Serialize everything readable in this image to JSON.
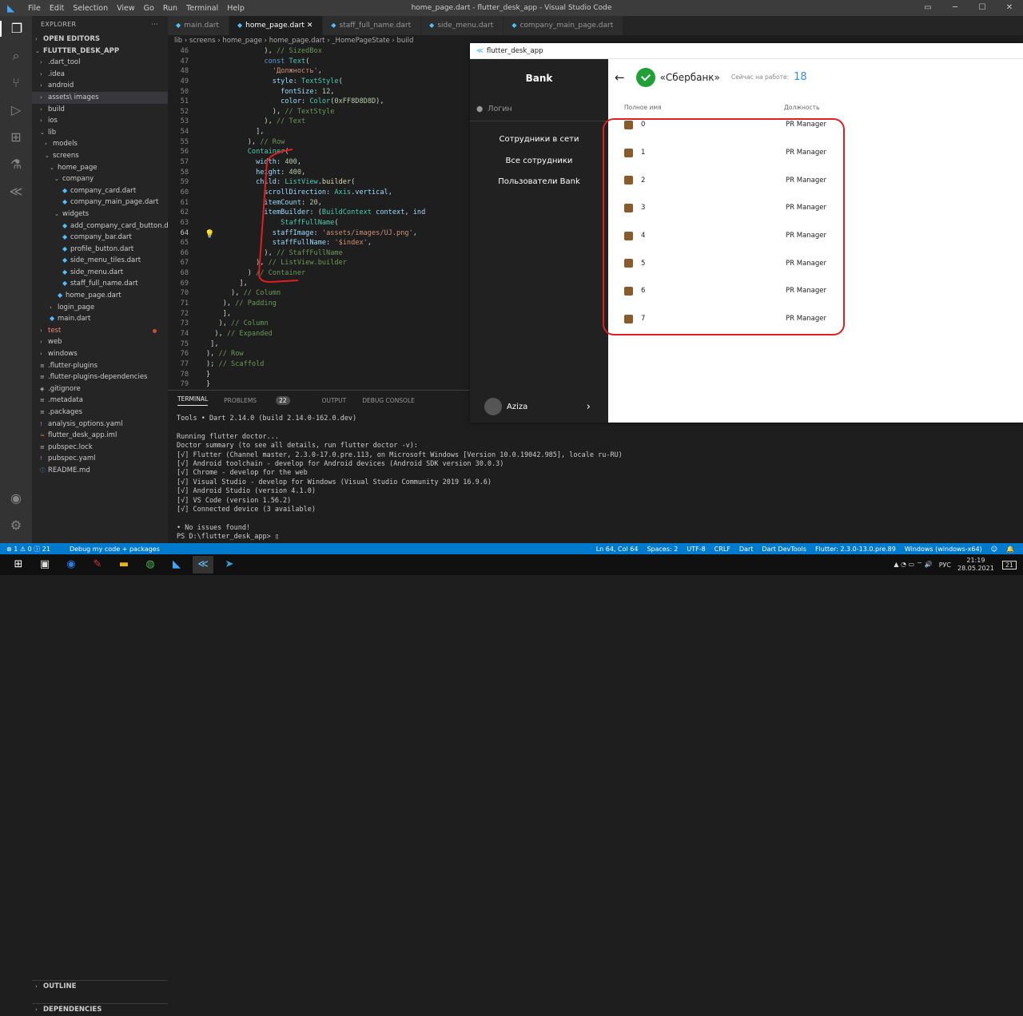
{
  "titlebar": {
    "menu": [
      "File",
      "Edit",
      "Selection",
      "View",
      "Go",
      "Run",
      "Terminal",
      "Help"
    ],
    "title": "home_page.dart - flutter_desk_app - Visual Studio Code"
  },
  "sidebar": {
    "header": "EXPLORER",
    "open_editors": "OPEN EDITORS",
    "project": "FLUTTER_DESK_APP",
    "tree": [
      ".dart_tool",
      ".idea",
      "android",
      "assets\\ images",
      "build",
      "ios",
      "lib",
      "models",
      "screens",
      "home_page",
      "company",
      "company_card.dart",
      "company_main_page.dart",
      "widgets",
      "add_company_card_button.dart",
      "company_bar.dart",
      "profile_button.dart",
      "side_menu_tiles.dart",
      "side_menu.dart",
      "staff_full_name.dart",
      "home_page.dart",
      "login_page",
      "main.dart",
      "test",
      "web",
      "windows",
      ".flutter-plugins",
      ".flutter-plugins-dependencies",
      ".gitignore",
      ".metadata",
      ".packages",
      "analysis_options.yaml",
      "flutter_desk_app.iml",
      "pubspec.lock",
      "pubspec.yaml",
      "README.md"
    ],
    "outline": "OUTLINE",
    "dependencies": "DEPENDENCIES"
  },
  "tabs": [
    "main.dart",
    "home_page.dart",
    "staff_full_name.dart",
    "side_menu.dart",
    "company_main_page.dart"
  ],
  "breadcrumb": "lib › screens › home_page › home_page.dart › _HomePageState › build",
  "editor": {
    "line_numbers": [
      "46",
      "47",
      "48",
      "49",
      "50",
      "51",
      "52",
      "53",
      "54",
      "55",
      "56",
      "57",
      "58",
      "59",
      "60",
      "61",
      "62",
      "63",
      "64",
      "65",
      "66",
      "67",
      "68",
      "69",
      "70",
      "71",
      "72",
      "73",
      "74",
      "75",
      "76",
      "77",
      "78",
      "79"
    ]
  },
  "panel": {
    "tabs": [
      "TERMINAL",
      "PROBLEMS",
      "OUTPUT",
      "DEBUG CONSOLE"
    ],
    "problems_count": "22",
    "terminal": [
      "Tools • Dart 2.14.0 (build 2.14.0-162.0.dev)",
      "",
      "Running flutter doctor...",
      "Doctor summary (to see all details, run flutter doctor -v):",
      "[√] Flutter (Channel master, 2.3.0-17.0.pre.113, on Microsoft Windows [Version 10.0.19042.985], locale ru-RU)",
      "[√] Android toolchain - develop for Android devices (Android SDK version 30.0.3)",
      "[√] Chrome - develop for the web",
      "[√] Visual Studio - develop for Windows (Visual Studio Community 2019 16.9.6)",
      "[√] Android Studio (version 4.1.0)",
      "[√] VS Code (version 1.56.2)",
      "[√] Connected device (3 available)",
      "",
      "• No issues found!",
      "PS D:\\flutter_desk_app> ▯"
    ]
  },
  "status": {
    "left": "⊗ 1 ⚠ 0 ⓘ 21",
    "debug": "Debug my code + packages",
    "right": [
      "Ln 64, Col 64",
      "Spaces: 2",
      "UTF-8",
      "CRLF",
      "Dart",
      "Dart DevTools",
      "Flutter: 2.3.0-13.0.pre.89",
      "Windows (windows-x64)"
    ]
  },
  "taskbar": {
    "lang": "РУС",
    "time": "21:19",
    "date": "28.05.2021",
    "notif": "21"
  },
  "app": {
    "window_title": "flutter_desk_app",
    "drawer_title": "Bank",
    "login_placeholder": "Логин",
    "menu": [
      "Сотрудники в сети",
      "Все сотрудники",
      "Пользователи Bank"
    ],
    "user": "Aziza",
    "company": "«Сбербанк»",
    "online_label": "Сейчас на работе:",
    "online_count": "18",
    "col_name": "Полное имя",
    "col_role": "Должность",
    "rows": [
      {
        "name": "0",
        "role": "PR Manager"
      },
      {
        "name": "1",
        "role": "PR Manager"
      },
      {
        "name": "2",
        "role": "PR Manager"
      },
      {
        "name": "3",
        "role": "PR Manager"
      },
      {
        "name": "4",
        "role": "PR Manager"
      },
      {
        "name": "5",
        "role": "PR Manager"
      },
      {
        "name": "6",
        "role": "PR Manager"
      },
      {
        "name": "7",
        "role": "PR Manager"
      }
    ]
  },
  "colors": {
    "accent": "#007acc",
    "sber": "#21a038",
    "annotation": "#e02020"
  }
}
